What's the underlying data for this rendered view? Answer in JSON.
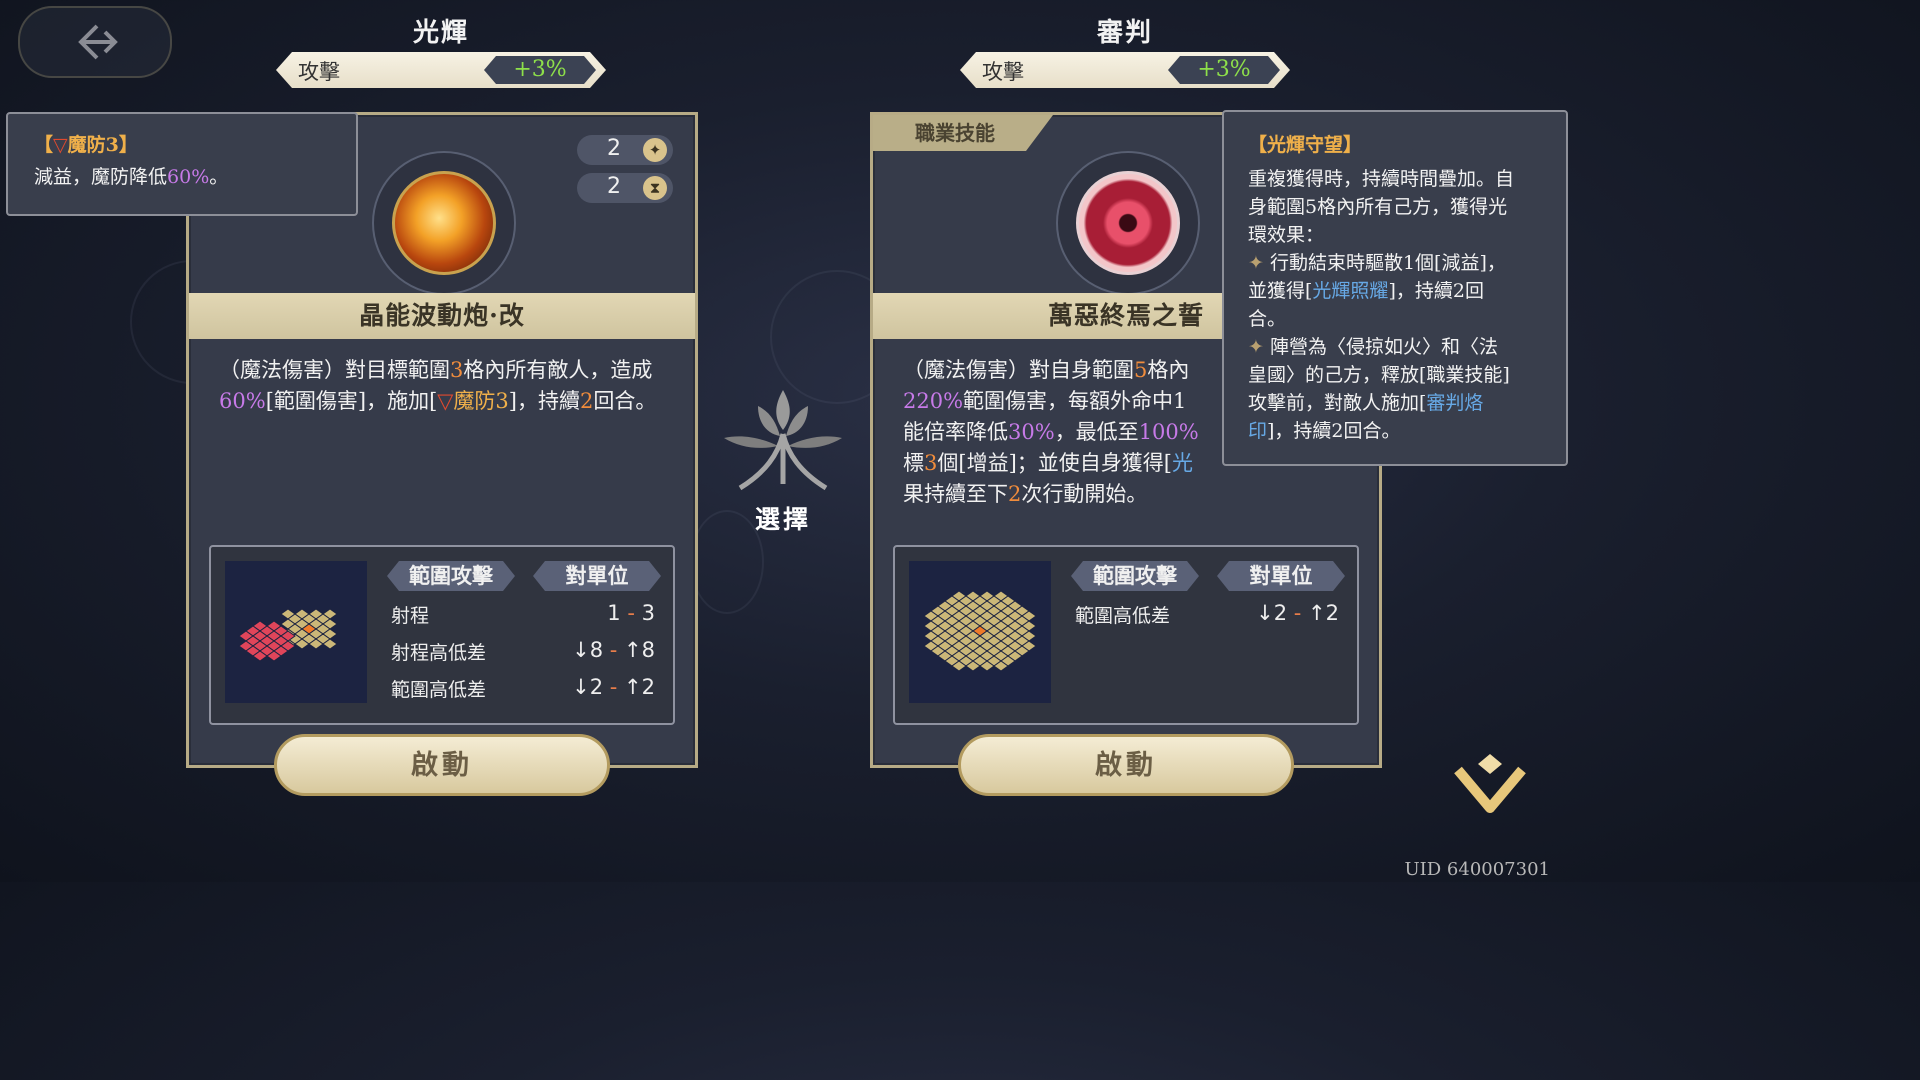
{
  "left": {
    "header": {
      "title": "光輝",
      "stat_label": "攻擊",
      "stat_value": "+3%"
    },
    "card": {
      "pill_1_value": "2",
      "pill_2_value": "2",
      "skill_name": "晶能波動炮·改",
      "desc": {
        "p1": "（魔法傷害）對目標範圍",
        "n1": "3",
        "p2": "格內所有敵人，造成",
        "n2": "60%",
        "p3": "[範圍傷害]，施加[",
        "tri": "▽",
        "debuff": "魔防3",
        "p4": "]，持續",
        "n3": "2",
        "p5": "回合。"
      },
      "tags": {
        "area": "範圍攻擊",
        "target": "對單位"
      },
      "rows": [
        {
          "label": "射程",
          "v1": "1",
          "v2": "3"
        },
        {
          "label": "射程高低差",
          "v1": "↓8",
          "v2": "↑8"
        },
        {
          "label": "範圍高低差",
          "v1": "↓2",
          "v2": "↑2"
        }
      ],
      "activate": "啟動"
    },
    "tooltip": {
      "open": "【",
      "tri": "▽",
      "title": "魔防3",
      "close": "】",
      "body_a": "減益，魔防降低",
      "body_n": "60%",
      "body_b": "。"
    }
  },
  "right": {
    "header": {
      "title": "審判",
      "stat_label": "攻擊",
      "stat_value": "+3%"
    },
    "card": {
      "corner_tag": "職業技能",
      "skill_name": "萬惡終焉之誓",
      "desc": {
        "p1": "（魔法傷害）對自身範圍",
        "n1": "5",
        "p2": "格內",
        "n2": "220%",
        "p3": "範圍傷害，每額外命中1",
        "p4": "能倍率降低",
        "n3": "30%",
        "p5": "，最低至",
        "n4": "100%",
        "p6": "標",
        "n5": "3",
        "p7": "個[增益]；並使自身獲得[",
        "link": "光",
        "p8": "果持續至下",
        "n6": "2",
        "p9": "次行動開始。"
      },
      "tags": {
        "area": "範圍攻擊",
        "target": "對單位"
      },
      "rows": [
        {
          "label": "範圍高低差",
          "v1": "↓2",
          "v2": "↑2"
        }
      ],
      "activate": "啟動"
    },
    "tooltip": {
      "title": "【光輝守望】",
      "l1": "重複獲得時，持續時間疊加。自",
      "l2": "身範圍5格內所有己方，獲得光",
      "l3": "環效果：",
      "b1a": "行動結束時驅散1個[減益]，",
      "b1b": "並獲得[",
      "b1link": "光輝照耀",
      "b1c": "]，持續2回",
      "b1d": "合。",
      "b2a": "陣營為〈侵掠如火〉和〈法",
      "b2b": "皇國〉的己方，釋放[職業技能]",
      "b2c": "攻擊前，對敵人施加[",
      "b2link1": "審判烙",
      "b2link2": "印",
      "b2d": "]，持續2回合。"
    }
  },
  "center": {
    "label": "選擇"
  },
  "uid": "UID 640007301",
  "icons": {
    "back": "back-arrow-icon",
    "sun": "sun-icon",
    "hourglass": "hourglass-icon",
    "emblem": "tree-emblem-icon",
    "down": "chevron-down-icon"
  },
  "colors": {
    "stat_positive": "#8ee04a",
    "number_highlight": "#f08c3c",
    "percent_highlight": "#c77ae8",
    "link_highlight": "#67a9e6",
    "tooltip_title": "#f0b04a"
  }
}
